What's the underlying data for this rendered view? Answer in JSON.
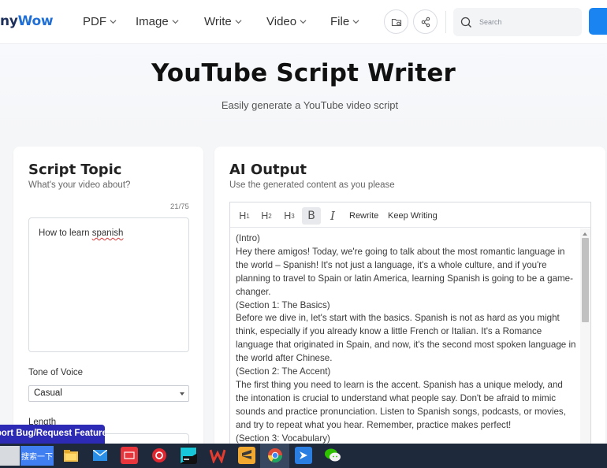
{
  "nav": {
    "logo_dark": "ny",
    "logo_blue": "Wow",
    "items": [
      {
        "label": "PDF"
      },
      {
        "label": "Image"
      },
      {
        "label": "Write"
      },
      {
        "label": "Video"
      },
      {
        "label": "File"
      }
    ],
    "search_placeholder": "Search"
  },
  "hero": {
    "title": "YouTube Script Writer",
    "subtitle": "Easily generate a YouTube video script"
  },
  "left": {
    "title": "Script Topic",
    "subtitle": "What's your video about?",
    "counter": "21/75",
    "topic_before": "How to learn ",
    "topic_spell": "spanish",
    "tone_label": "Tone of Voice",
    "tone_value": "Casual",
    "length_label": "Length"
  },
  "right": {
    "title": "AI Output",
    "subtitle": "Use the generated content as you please",
    "toolbar": {
      "h1": "H",
      "h1_sub": "1",
      "h2": "H",
      "h2_sub": "2",
      "h3": "H",
      "h3_sub": "3",
      "bold": "B",
      "italic": "I",
      "rewrite": "Rewrite",
      "keep_writing": "Keep Writing"
    },
    "output": [
      "(Intro)",
      "Hey there amigos! Today, we're going to talk about the most romantic language in the world – Spanish! It's not just a language, it's a whole culture, and if you're planning to travel to Spain or latin America, learning Spanish is going to be a game-changer.",
      "(Section 1: The Basics)",
      "Before we dive in, let's start with the basics. Spanish is not as hard as you might think, especially if you already know a little French or Italian. It's a Romance language that originated in Spain, and now, it's the second most spoken language in the world after Chinese.",
      "(Section 2: The Accent)",
      "The first thing you need to learn is the accent. Spanish has a unique melody, and the intonation is crucial to understand what people say. Don't be afraid to mimic sounds and practice pronunciation. Listen to Spanish songs, podcasts, or movies, and try to repeat what you hear. Remember, practice makes perfect!",
      "(Section 3: Vocabulary)"
    ]
  },
  "feedback": {
    "label": "Report Bug/Request Feature"
  },
  "taskbar": {
    "search_button": "搜索一下",
    "apps": [
      "file-explorer",
      "mail",
      "app-red",
      "netease-music",
      "webstorm",
      "wps",
      "sublime",
      "chrome",
      "feishu",
      "wechat"
    ]
  },
  "colors": {
    "brand_blue": "#1a85f0",
    "feedback_bar": "#2d2ab6",
    "taskbar": "#1e2a3c"
  }
}
